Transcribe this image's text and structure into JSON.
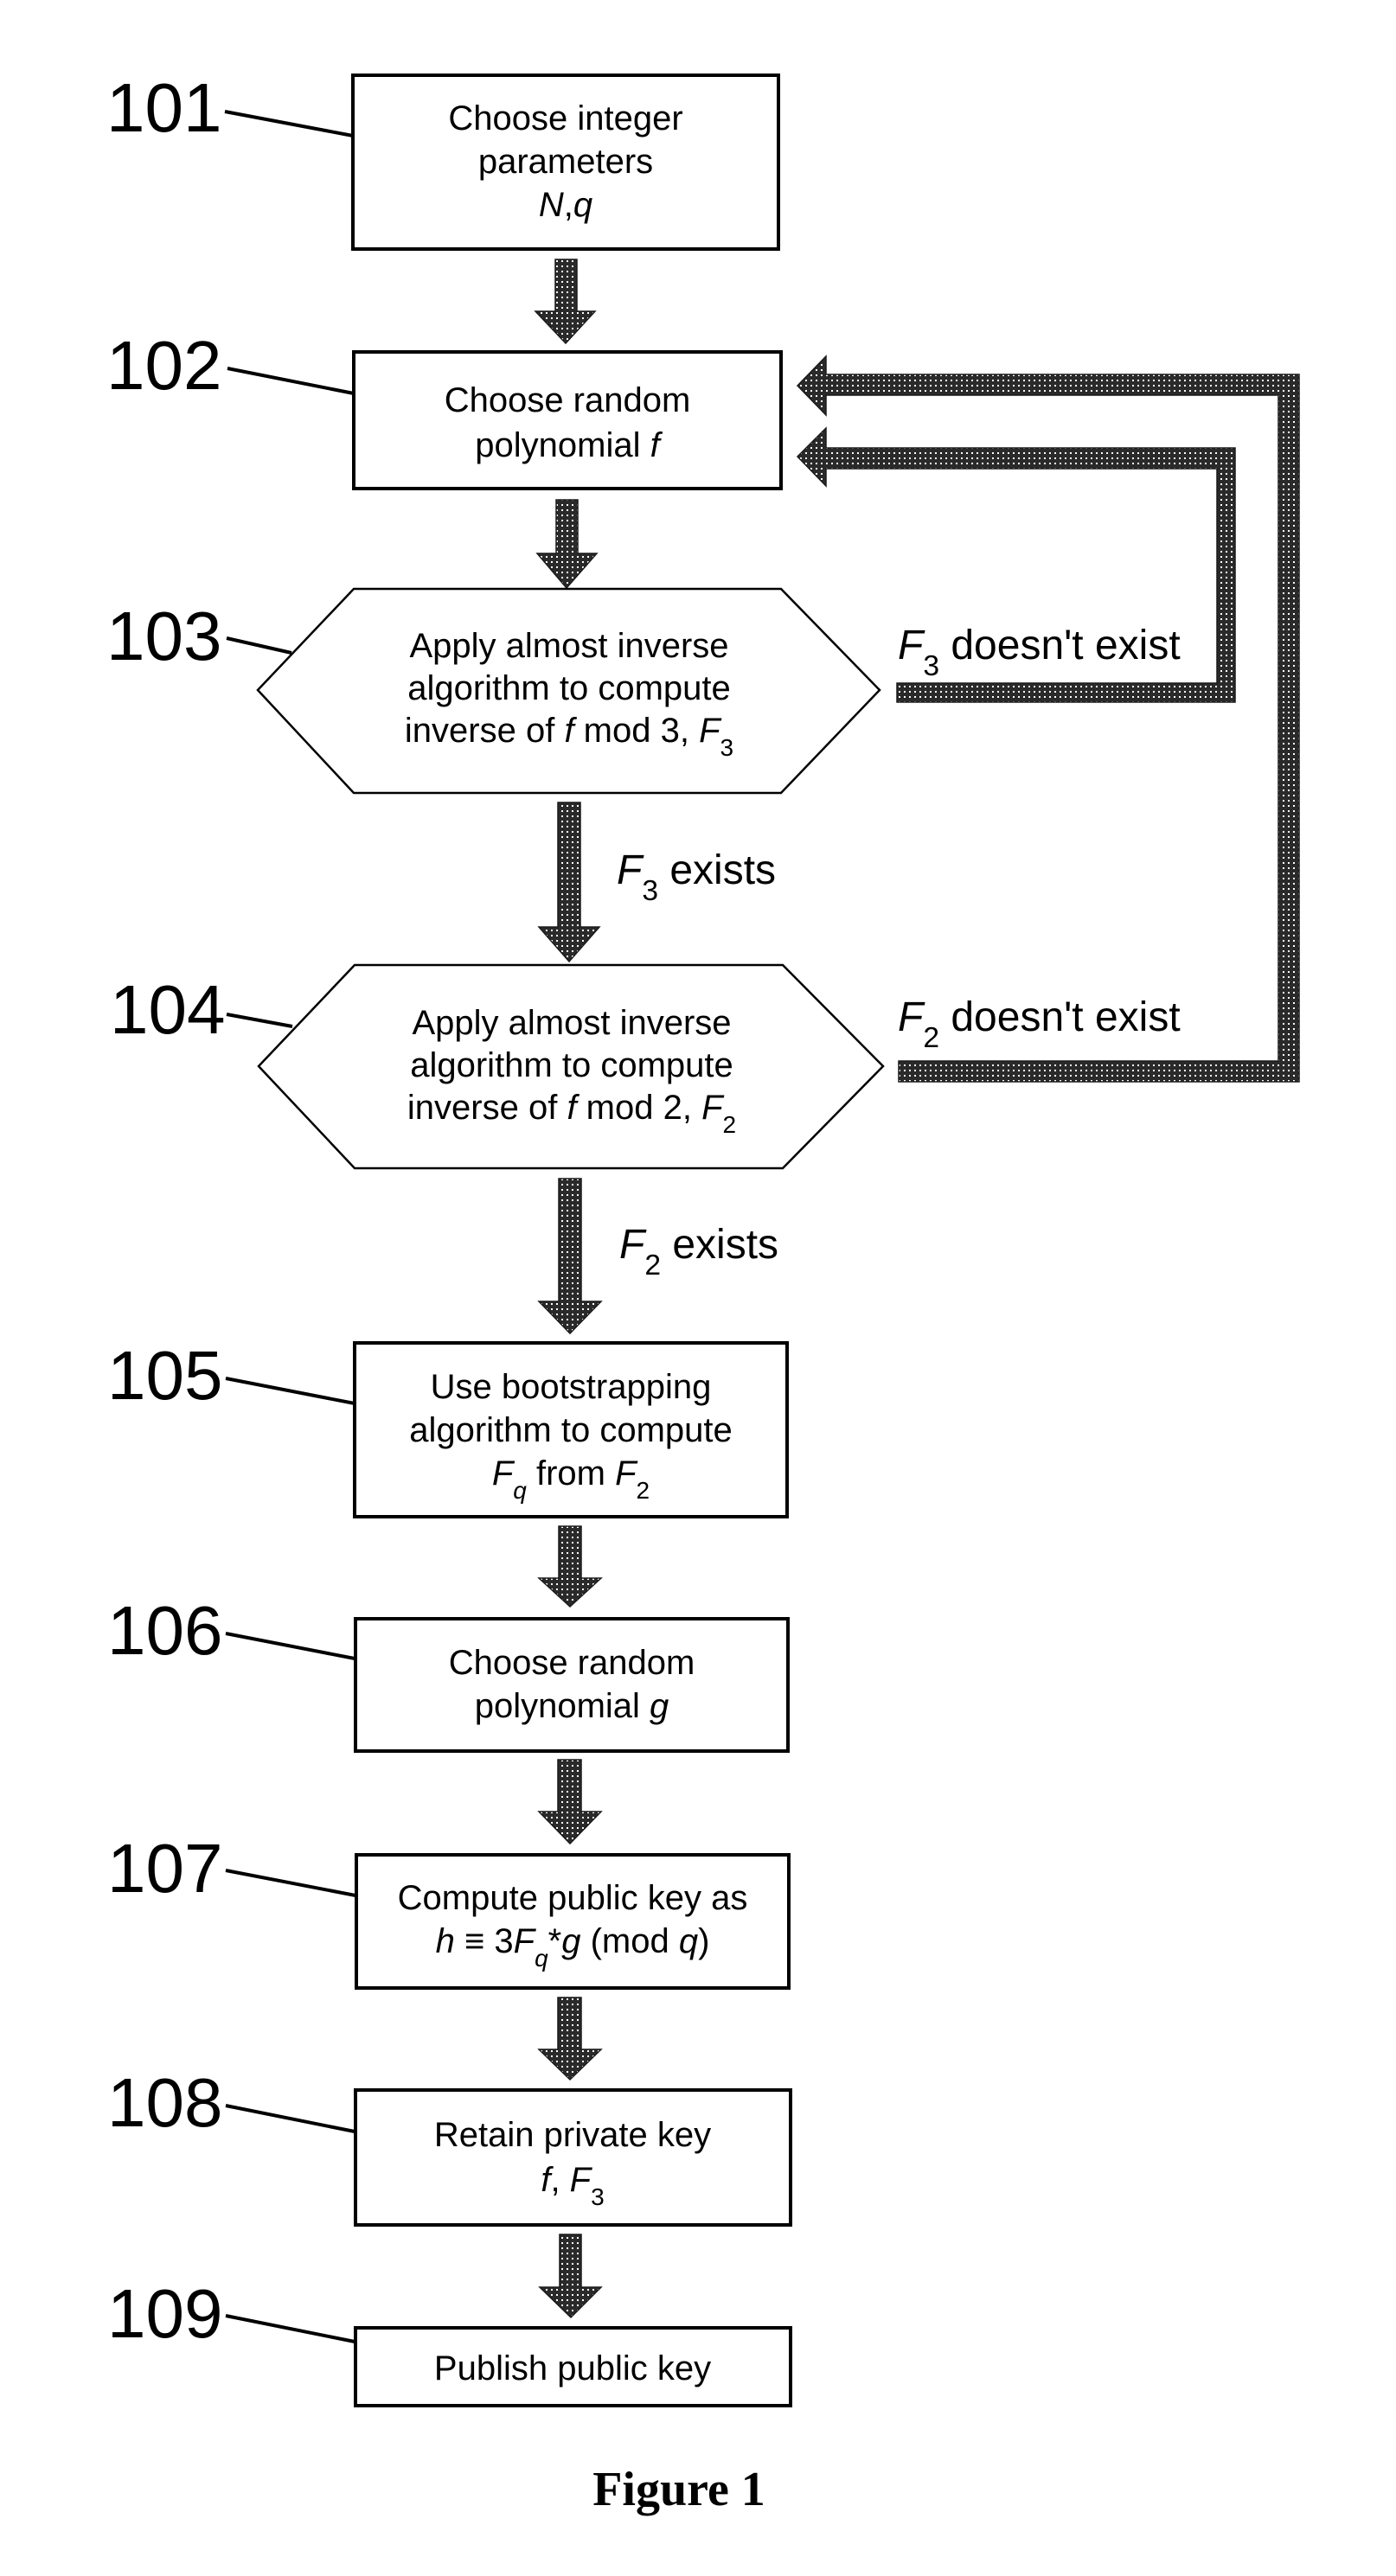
{
  "figure": {
    "caption": "Figure 1",
    "colors": {
      "ink": "#000000",
      "hatch": "#2a2a2a",
      "background": "#ffffff"
    }
  },
  "steps": [
    {
      "id": "101",
      "shape": "box",
      "lines": [
        [
          {
            "t": "Choose integer"
          }
        ],
        [
          {
            "t": "parameters"
          }
        ],
        [
          {
            "t": "N",
            "i": true
          },
          {
            "t": ","
          },
          {
            "t": "q",
            "i": true
          }
        ]
      ]
    },
    {
      "id": "102",
      "shape": "box",
      "lines": [
        [
          {
            "t": "Choose random"
          }
        ],
        [
          {
            "t": "polynomial "
          },
          {
            "t": "f",
            "i": true
          }
        ]
      ]
    },
    {
      "id": "103",
      "shape": "hexagon",
      "lines": [
        [
          {
            "t": "Apply almost inverse"
          }
        ],
        [
          {
            "t": "algorithm to compute"
          }
        ],
        [
          {
            "t": "inverse of "
          },
          {
            "t": "f",
            "i": true
          },
          {
            "t": " mod 3, "
          },
          {
            "t": "F",
            "i": true
          },
          {
            "t": "3",
            "sub": true
          }
        ]
      ]
    },
    {
      "id": "104",
      "shape": "hexagon",
      "lines": [
        [
          {
            "t": "Apply almost inverse"
          }
        ],
        [
          {
            "t": "algorithm to compute"
          }
        ],
        [
          {
            "t": "inverse of "
          },
          {
            "t": "f",
            "i": true
          },
          {
            "t": " mod 2, "
          },
          {
            "t": "F",
            "i": true
          },
          {
            "t": "2",
            "sub": true
          }
        ]
      ]
    },
    {
      "id": "105",
      "shape": "box",
      "lines": [
        [
          {
            "t": "Use bootstrapping"
          }
        ],
        [
          {
            "t": "algorithm to compute"
          }
        ],
        [
          {
            "t": "F",
            "i": true
          },
          {
            "t": "q",
            "i": true,
            "sub": true
          },
          {
            "t": " from "
          },
          {
            "t": "F",
            "i": true
          },
          {
            "t": "2",
            "sub": true
          }
        ]
      ]
    },
    {
      "id": "106",
      "shape": "box",
      "lines": [
        [
          {
            "t": "Choose random"
          }
        ],
        [
          {
            "t": "polynomial "
          },
          {
            "t": "g",
            "i": true
          }
        ]
      ]
    },
    {
      "id": "107",
      "shape": "box",
      "lines": [
        [
          {
            "t": "Compute public key as"
          }
        ],
        [
          {
            "t": "h",
            "i": true
          },
          {
            "t": " ≡ 3"
          },
          {
            "t": "F",
            "i": true
          },
          {
            "t": "q",
            "i": true,
            "sub": true
          },
          {
            "t": "*"
          },
          {
            "t": "g",
            "i": true
          },
          {
            "t": " (mod "
          },
          {
            "t": "q",
            "i": true
          },
          {
            "t": ")"
          }
        ]
      ]
    },
    {
      "id": "108",
      "shape": "box",
      "lines": [
        [
          {
            "t": "Retain private key"
          }
        ],
        [
          {
            "t": "f",
            "i": true
          },
          {
            "t": ", "
          },
          {
            "t": "F",
            "i": true
          },
          {
            "t": "3",
            "sub": true
          }
        ]
      ]
    },
    {
      "id": "109",
      "shape": "box",
      "lines": [
        [
          {
            "t": "Publish public key"
          }
        ]
      ]
    }
  ],
  "conditions": {
    "f3_exists": [
      {
        "t": "F",
        "i": true
      },
      {
        "t": "3",
        "sub": true
      },
      {
        "t": " exists"
      }
    ],
    "f2_exists": [
      {
        "t": "F",
        "i": true
      },
      {
        "t": "2",
        "sub": true
      },
      {
        "t": " exists"
      }
    ],
    "f3_not_exist": [
      {
        "t": "F",
        "i": true
      },
      {
        "t": "3",
        "sub": true
      },
      {
        "t": " doesn't exist"
      }
    ],
    "f2_not_exist": [
      {
        "t": "F",
        "i": true
      },
      {
        "t": "2",
        "sub": true
      },
      {
        "t": " doesn't exist"
      }
    ]
  }
}
